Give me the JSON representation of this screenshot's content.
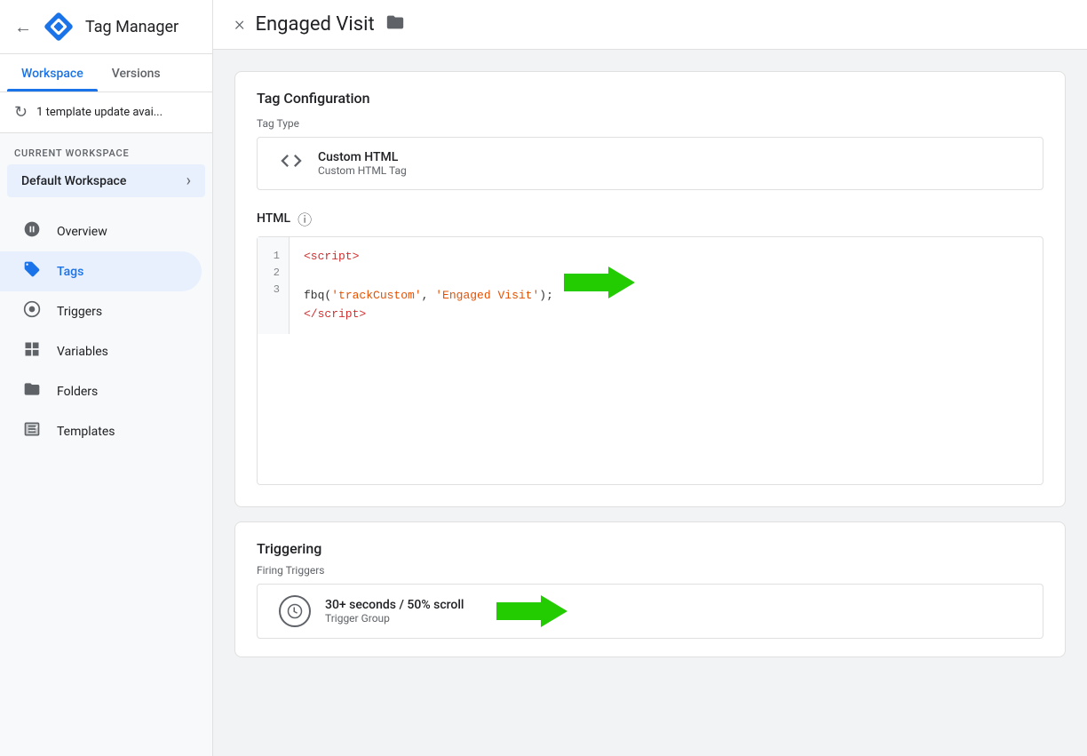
{
  "app": {
    "title": "Tag Manager",
    "back_label": "←"
  },
  "sidebar": {
    "tabs": [
      {
        "label": "Workspace",
        "active": true
      },
      {
        "label": "Versions",
        "active": false
      }
    ],
    "update_banner": "1 template update avai...",
    "current_workspace_label": "CURRENT WORKSPACE",
    "workspace_name": "Default Workspace",
    "nav_items": [
      {
        "label": "Overview",
        "icon": "clock",
        "active": false
      },
      {
        "label": "Tags",
        "icon": "tag",
        "active": true
      },
      {
        "label": "Triggers",
        "icon": "circle",
        "active": false
      },
      {
        "label": "Variables",
        "icon": "grid",
        "active": false
      },
      {
        "label": "Folders",
        "icon": "folder",
        "active": false
      },
      {
        "label": "Templates",
        "icon": "template",
        "active": false
      }
    ]
  },
  "detail": {
    "close_label": "×",
    "title": "Engaged Visit",
    "sections": {
      "tag_config": {
        "title": "Tag Configuration",
        "tag_type_label": "Tag Type",
        "type_name": "Custom HTML",
        "type_sub": "Custom HTML Tag",
        "html_label": "HTML",
        "code_lines": [
          {
            "number": "1",
            "content": "<script>",
            "type": "tag"
          },
          {
            "number": "2",
            "content": "fbq('trackCustom', 'Engaged Visit');",
            "type": "mixed",
            "has_arrow": true
          },
          {
            "number": "3",
            "content": "</script>",
            "type": "tag"
          }
        ]
      },
      "triggering": {
        "title": "Triggering",
        "firing_label": "Firing Triggers",
        "trigger_name": "30+ seconds / 50% scroll",
        "trigger_type": "Trigger Group",
        "has_arrow": true
      }
    }
  },
  "colors": {
    "accent": "#1a73e8",
    "active_nav": "#e8f0fe",
    "green": "#2e7d32",
    "arrow_green": "#33cc00"
  }
}
